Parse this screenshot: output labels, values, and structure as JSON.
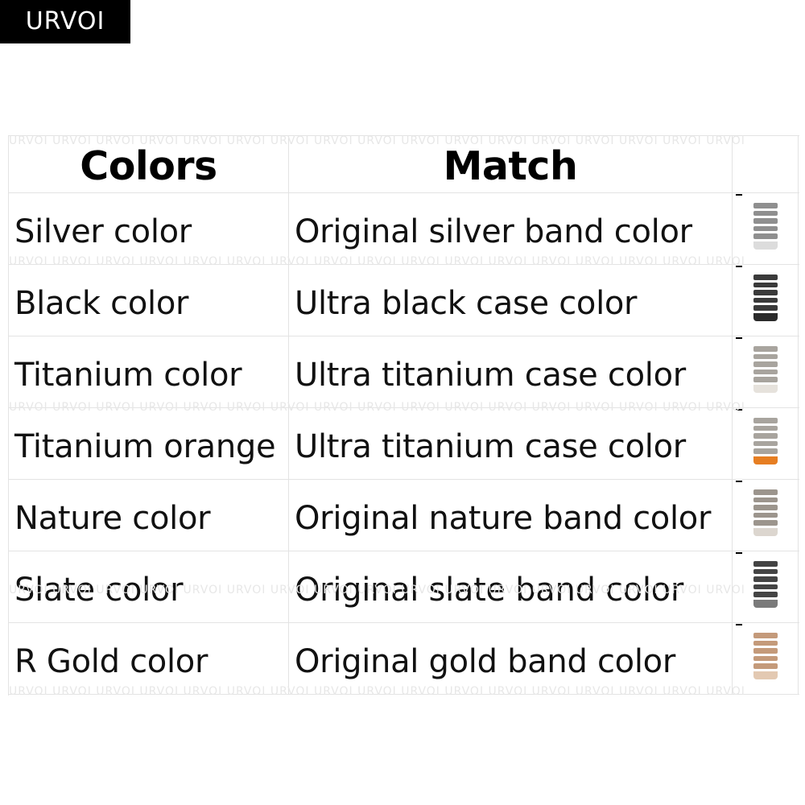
{
  "brand": "URVOI",
  "watermark": "URVOI URVOI URVOI URVOI URVOI URVOI URVOI URVOI URVOI URVOI URVOI URVOI URVOI URVOI URVOI URVOI URVOI",
  "table": {
    "headers": [
      "Colors",
      "Match",
      ""
    ],
    "rows": [
      {
        "color": "Silver color",
        "match": "Original silver band color",
        "band": "#8f8f8f",
        "foot": "#dcdcdc"
      },
      {
        "color": "Black color",
        "match": "Ultra black case color",
        "band": "#3a3a3a",
        "foot": "#2b2b2b"
      },
      {
        "color": "Titanium color",
        "match": "Ultra titanium case color",
        "band": "#a8a49e",
        "foot": "#e6e2dc"
      },
      {
        "color": "Titanium orange",
        "match": "Ultra titanium case color",
        "band": "#a8a49e",
        "foot": "#e67e22"
      },
      {
        "color": "Nature color",
        "match": "Original nature band color",
        "band": "#9c958d",
        "foot": "#dcd6cf"
      },
      {
        "color": "Slate color",
        "match": "Original slate band color",
        "band": "#444444",
        "foot": "#7a7a7a"
      },
      {
        "color": "R Gold color",
        "match": "Original gold band color",
        "band": "#c49a7a",
        "foot": "#e3c9b2"
      }
    ]
  }
}
